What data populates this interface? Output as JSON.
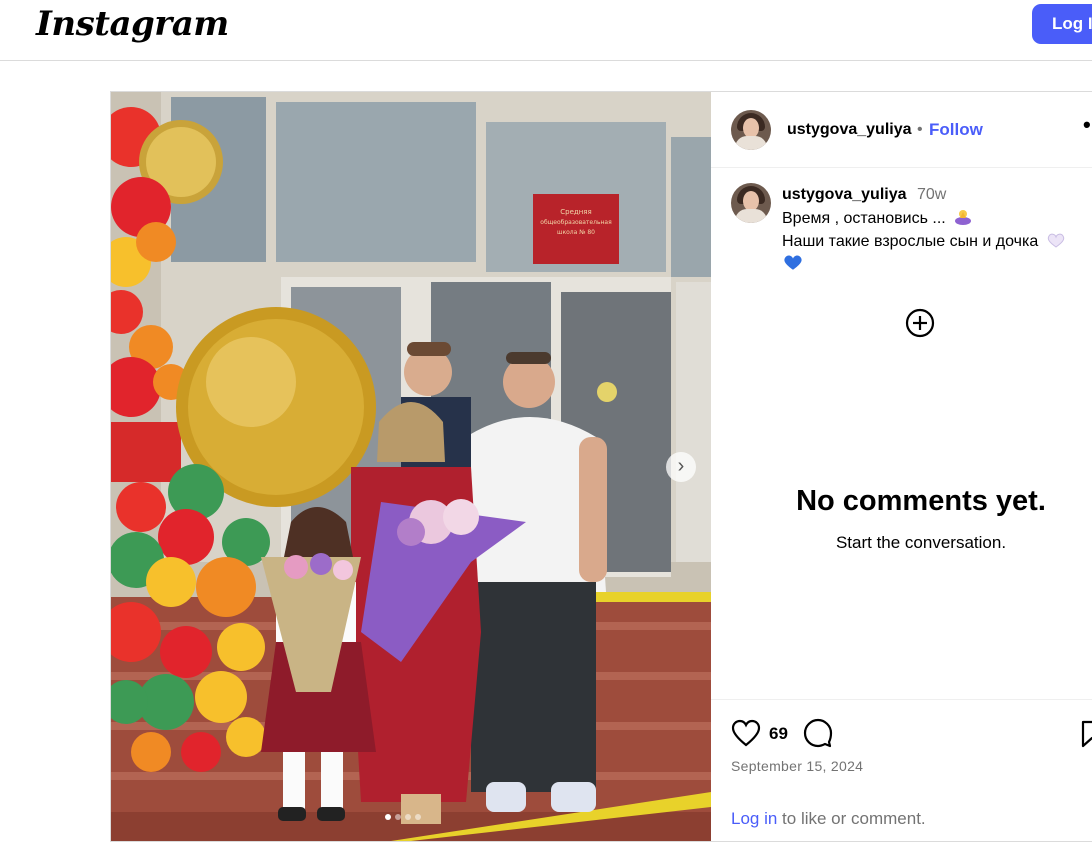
{
  "header": {
    "logo_text": "Instagram",
    "login_button": "Log I"
  },
  "post": {
    "username": "ustygova_yuliya",
    "separator": "•",
    "follow_label": "Follow",
    "more_label": "•",
    "caption": {
      "username": "ustygova_yuliya",
      "time_ago": "70w",
      "line1": "Время , остановись ...",
      "line2": "Наши такие взрослые сын и дочка"
    },
    "empty_state": {
      "title": "No comments yet.",
      "subtitle": "Start the conversation."
    },
    "likes_count": "69",
    "date": "September 15, 2024",
    "login_prompt": {
      "link": "Log in",
      "text": " to like or comment."
    },
    "photo": {
      "sign_text": "Средняя общеобразовательная школа № 80",
      "carousel_total": 4,
      "carousel_active": 1
    }
  },
  "icons": {
    "next": "chevron-right-icon",
    "like": "heart-icon",
    "comment": "comment-icon",
    "save": "bookmark-icon",
    "add": "plus-circle-icon",
    "more": "more-icon"
  },
  "colors": {
    "brand_blue": "#4a5df9",
    "muted_text": "#737373",
    "border": "#dbdbdb"
  }
}
